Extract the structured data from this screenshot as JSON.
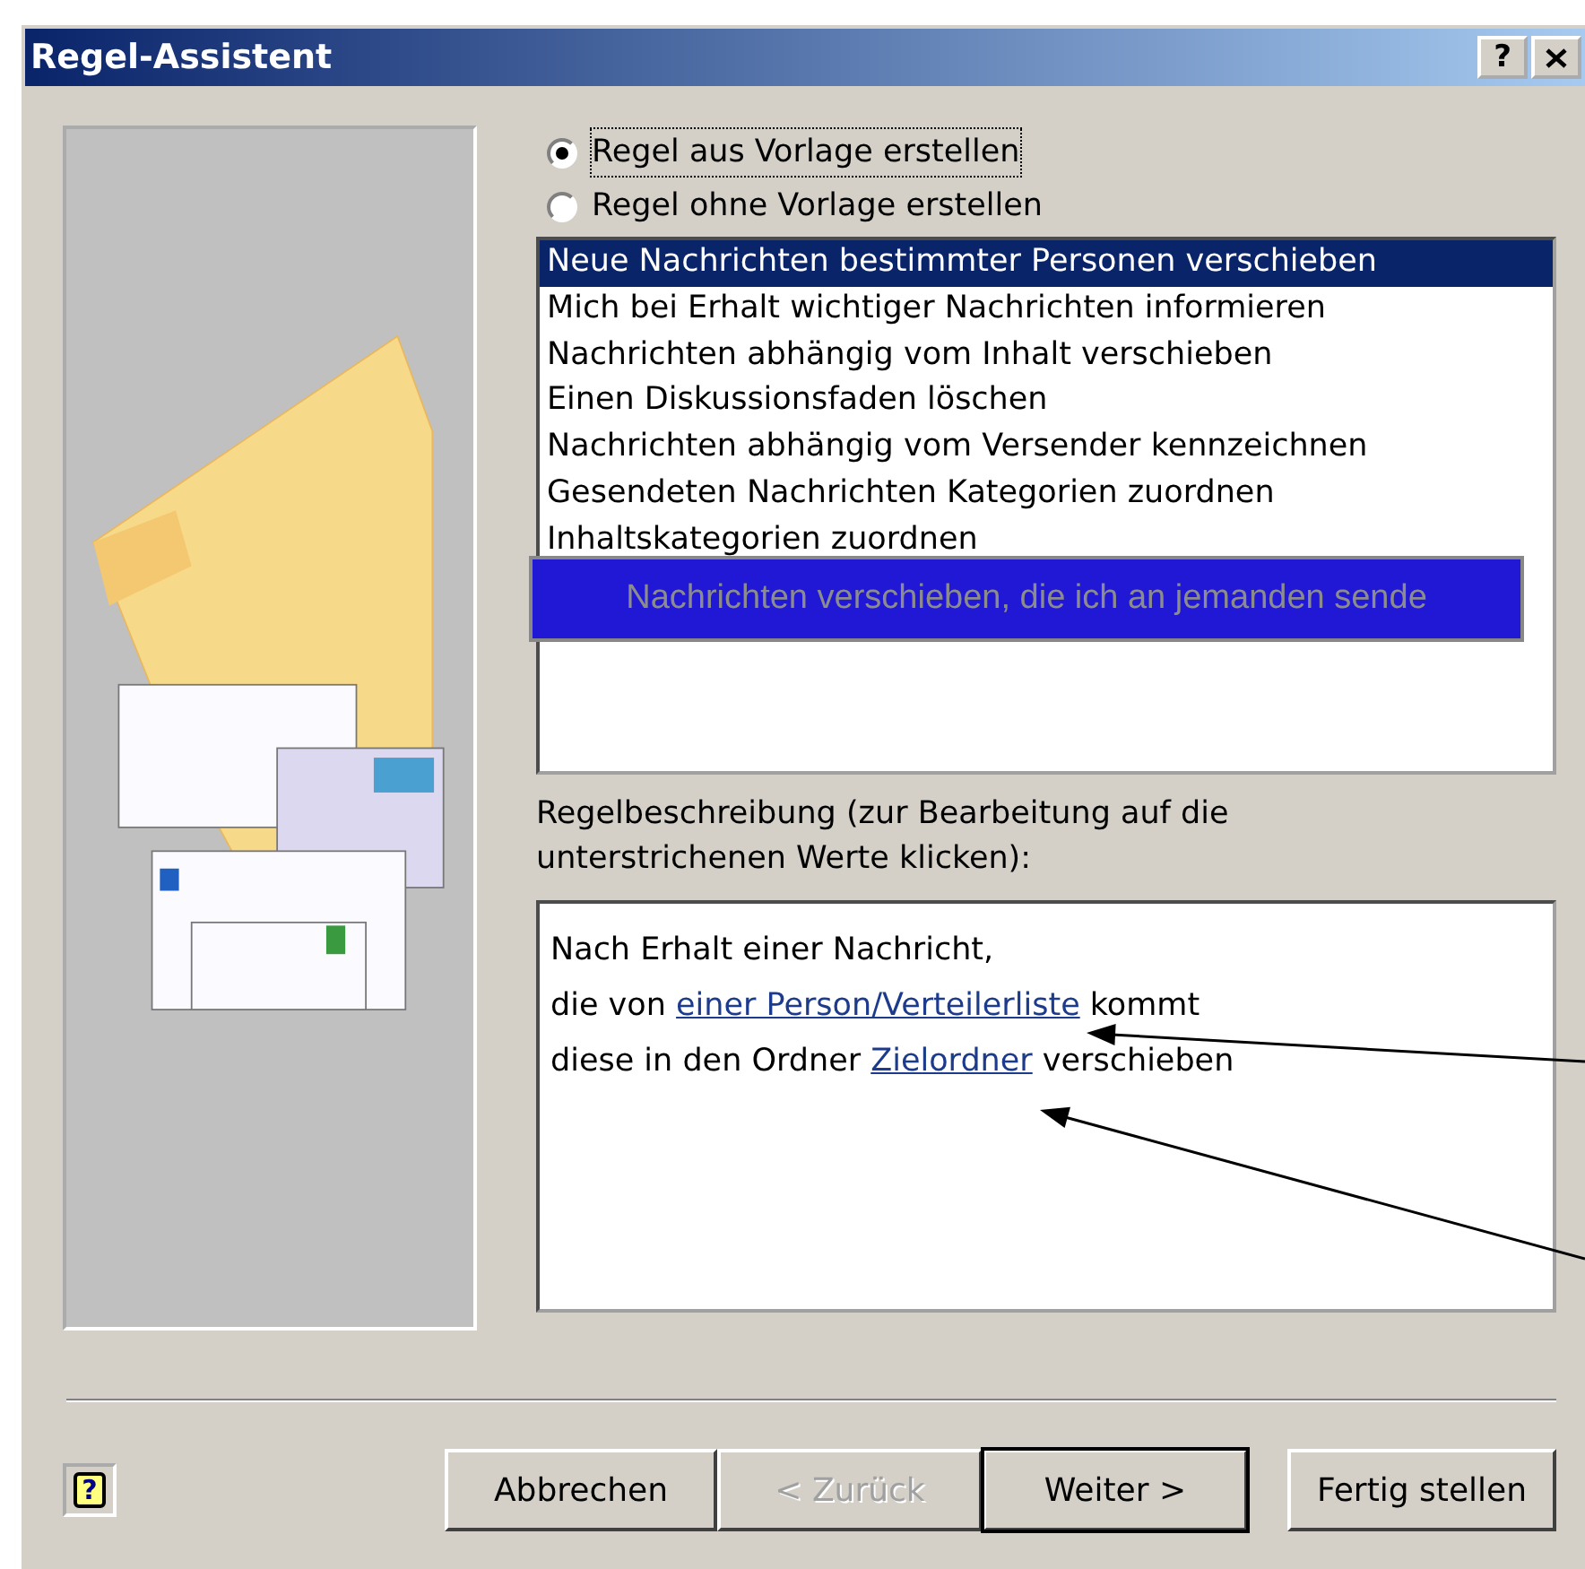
{
  "window": {
    "title": "Regel-Assistent",
    "title_buttons": [
      {
        "kind": "help",
        "label": "?"
      },
      {
        "kind": "close"
      }
    ]
  },
  "options": [
    {
      "label": "Regel aus Vorlage erstellen",
      "selected": true,
      "focused": true
    },
    {
      "label": "Regel ohne Vorlage erstellen",
      "selected": false,
      "focused": false
    }
  ],
  "templates": [
    {
      "label": "Neue Nachrichten bestimmter Personen verschieben",
      "selected": true
    },
    {
      "label": "Mich bei Erhalt wichtiger Nachrichten informieren",
      "selected": false
    },
    {
      "label": "Nachrichten abhängig vom Inhalt verschieben",
      "selected": false
    },
    {
      "label": "Einen Diskussionsfaden löschen",
      "selected": false
    },
    {
      "label": "Nachrichten abhängig vom Versender kennzeichnen",
      "selected": false
    },
    {
      "label": "Gesendeten Nachrichten Kategorien zuordnen",
      "selected": false
    },
    {
      "label": "Inhaltskategorien zuordnen",
      "selected": false
    }
  ],
  "tooltip": {
    "text": "Nachrichten verschieben, die ich an jemanden sende"
  },
  "description": {
    "label": "Regelbeschreibung (zur Bearbeitung auf die unterstrichenen Werte klicken):",
    "lines": [
      [
        {
          "kind": "text",
          "text": "Nach Erhalt einer Nachricht,"
        }
      ],
      [
        {
          "kind": "text",
          "text": "die von "
        },
        {
          "kind": "link",
          "text": "einer Person/Verteilerliste"
        },
        {
          "kind": "text",
          "text": " kommt"
        }
      ],
      [
        {
          "kind": "text",
          "text": "diese in den Ordner "
        },
        {
          "kind": "link",
          "text": "Zielordner"
        },
        {
          "kind": "text",
          "text": " verschieben"
        }
      ]
    ]
  },
  "help_button": {
    "label": "?"
  },
  "buttons": [
    {
      "label": "Abbrechen",
      "disabled": false,
      "default": false
    },
    {
      "label": "< Zurück",
      "disabled": true,
      "default": false
    },
    {
      "label": "Weiter >",
      "disabled": false,
      "default": true
    },
    {
      "label": "Fertig stellen",
      "disabled": false,
      "default": false
    }
  ]
}
